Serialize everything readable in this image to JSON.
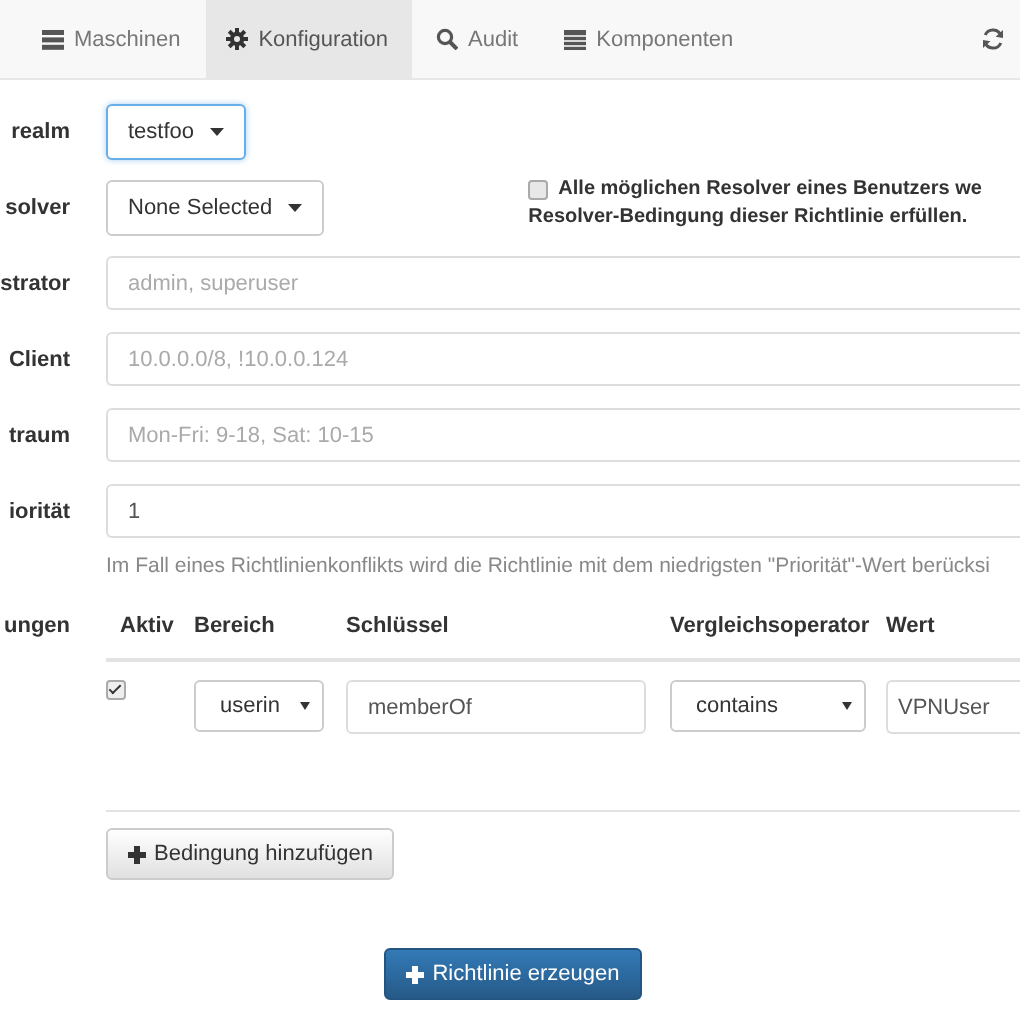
{
  "nav": {
    "tabs": [
      {
        "label": "Maschinen",
        "selected": false
      },
      {
        "label": "Konfiguration",
        "selected": true
      },
      {
        "label": "Audit",
        "selected": false
      },
      {
        "label": "Komponenten",
        "selected": false
      }
    ]
  },
  "form": {
    "fields": [
      {
        "kind": "select",
        "label": "realm",
        "value": "testfoo",
        "focused": true
      },
      {
        "kind": "select",
        "label": "solver",
        "value": "None Selected",
        "focused": false,
        "option": {
          "checked": false,
          "text": "Alle möglichen Resolver eines Benutzers we",
          "text_2": "Resolver-Bedingung dieser Richtlinie erfüllen."
        }
      },
      {
        "kind": "input",
        "label": "strator",
        "placeholder": "admin, superuser"
      },
      {
        "kind": "input",
        "label": "Client",
        "placeholder": "10.0.0.0/8, !10.0.0.124"
      },
      {
        "kind": "input",
        "label": "traum",
        "placeholder": "Mon-Fri: 9-18, Sat: 10-15"
      },
      {
        "kind": "input",
        "label": "iorität",
        "value": "1",
        "help": "Im Fall eines Richtlinienkonflikts wird die Richtlinie mit dem niedrigsten \"Priorität\"-Wert berücksi"
      }
    ]
  },
  "conditions": {
    "label": "ungen",
    "columns": [
      "Aktiv",
      "Bereich",
      "Schlüssel",
      "Vergleichsoperator",
      "Wert"
    ],
    "rows": [
      {
        "checked": true,
        "section": "userin",
        "key": "memberOf",
        "comparator": "contains",
        "value": "VPNUser"
      }
    ],
    "add_button": "Bedingung hinzufügen"
  },
  "submit_button": "Richtlinie erzeugen"
}
